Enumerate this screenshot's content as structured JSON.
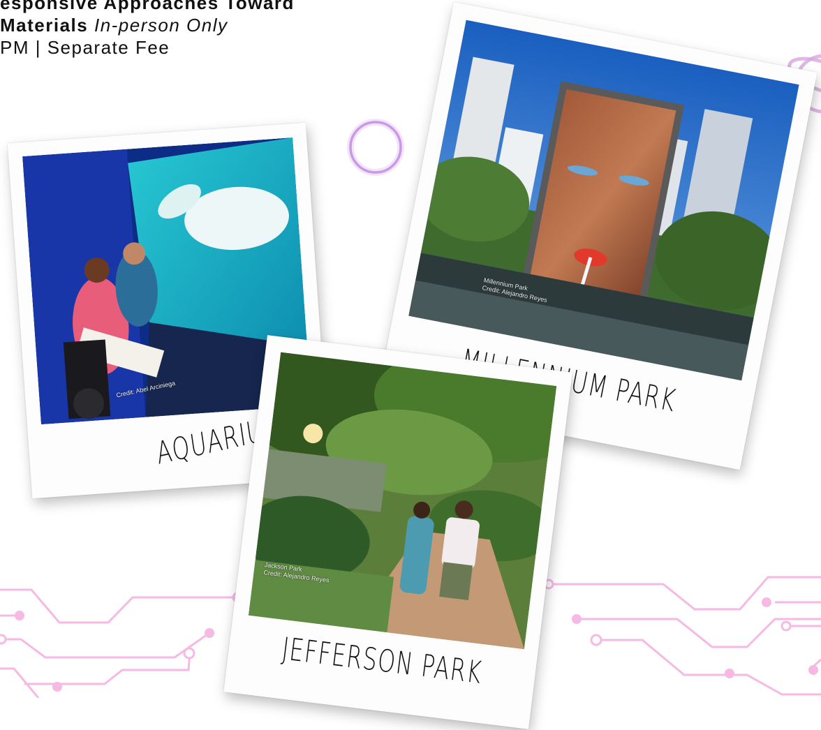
{
  "header": {
    "line1_bold": "esponsive Approaches Toward",
    "line2_bold": "Materials",
    "line2_italic": "In-person Only",
    "line3": "PM | Separate Fee"
  },
  "photos": {
    "aquarium": {
      "caption": "AQUARIUM",
      "credit": "Credit: Abel Arciniega"
    },
    "millennium": {
      "caption": "MILLENNIUM PARK",
      "credit_line1": "Millennium Park",
      "credit_line2": "Credit: Alejandro Reyes"
    },
    "jefferson": {
      "caption": "JEFFERSON PARK",
      "credit_line1": "Jackson Park",
      "credit_line2": "Credit: Alejandro Reyes"
    }
  },
  "colors": {
    "circuit": "#f6b9e4",
    "ring": "#c79ae8"
  }
}
